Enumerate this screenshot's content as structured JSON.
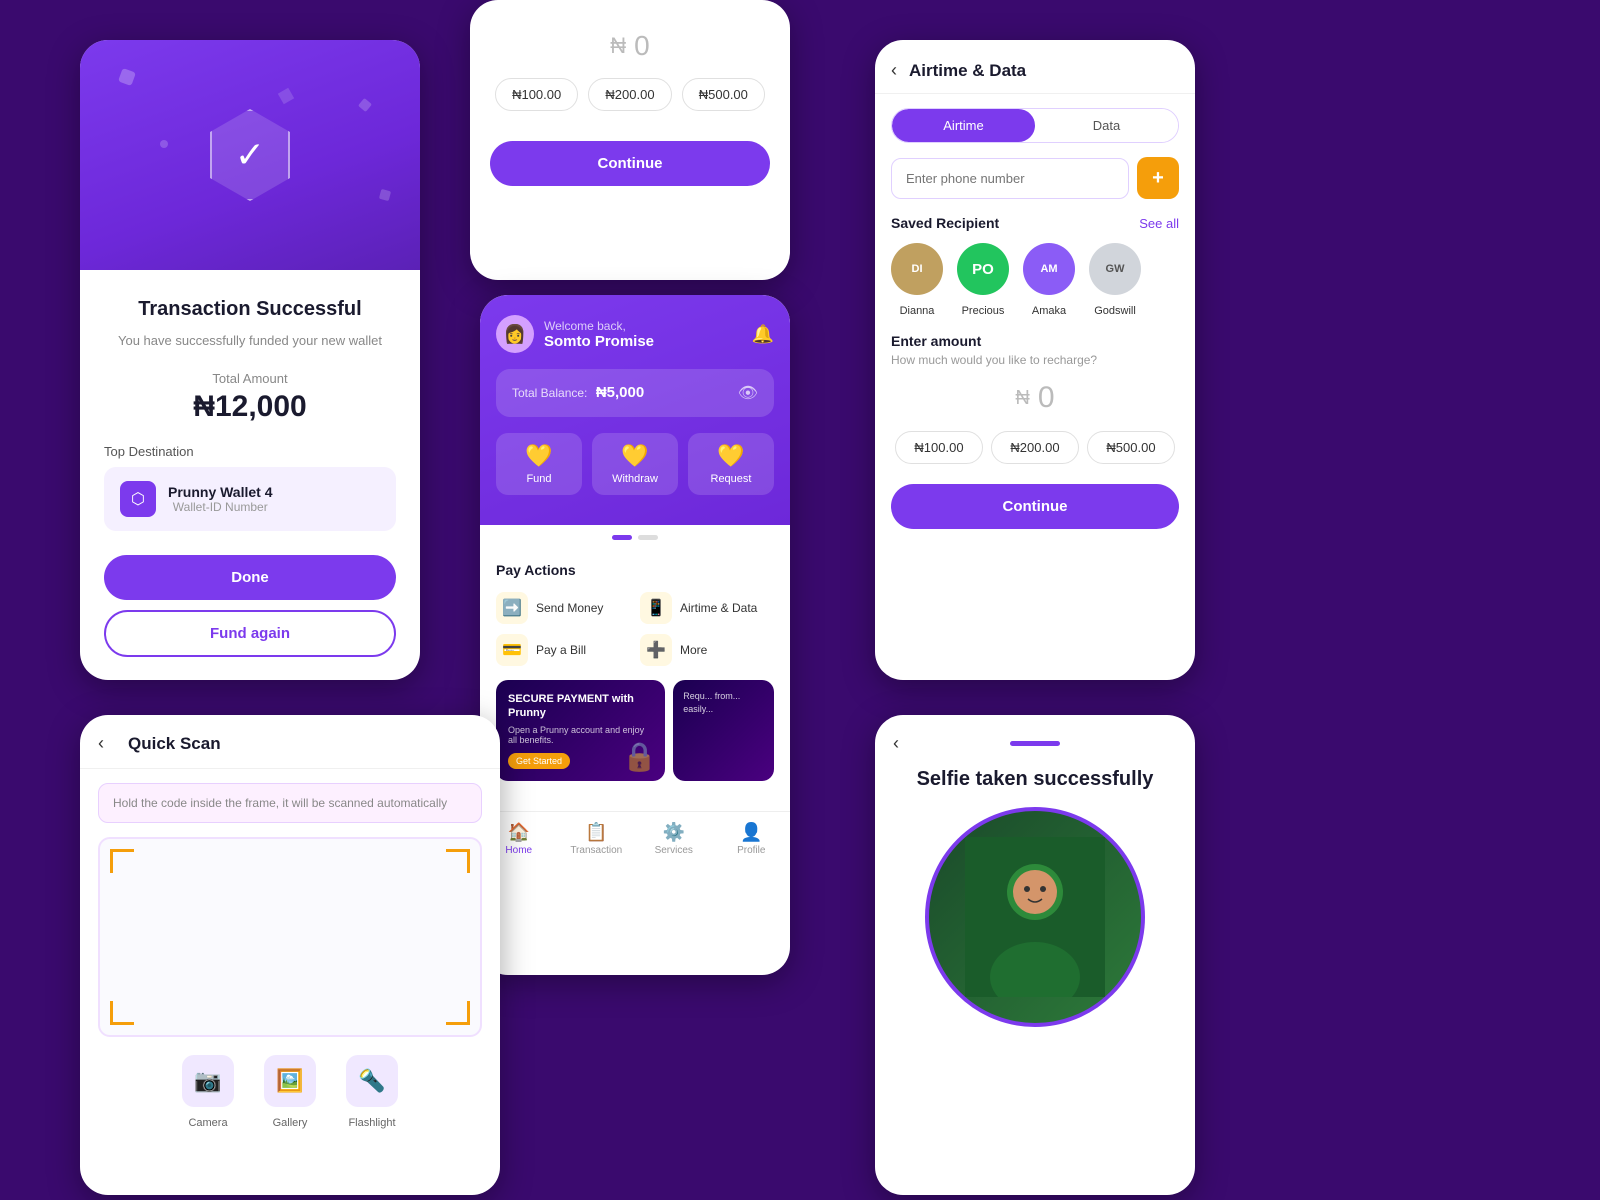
{
  "colors": {
    "purple": "#7c3aed",
    "dark_purple": "#3a0a6e",
    "yellow": "#f59e0b",
    "white": "#ffffff"
  },
  "card_transaction": {
    "badge_check": "✓",
    "title": "Transaction Successful",
    "subtitle": "You have successfully funded your new wallet",
    "total_amount_label": "Total Amount",
    "amount": "₦12,000",
    "top_destination_label": "Top Destination",
    "wallet_name": "Prunny Wallet 4",
    "wallet_sub": "Wallet-ID Number",
    "btn_done": "Done",
    "btn_fund_again": "Fund again"
  },
  "card_airtime_top": {
    "naira_symbol": "₦",
    "amount": "0",
    "quick_amounts": [
      "₦100.00",
      "₦200.00",
      "₦500.00"
    ],
    "btn_continue": "Continue"
  },
  "card_home": {
    "welcome": "Welcome back,",
    "user_name": "Somto Promise",
    "total_balance_label": "Total Balance:",
    "total_balance": "₦5,000",
    "actions": [
      {
        "label": "Fund",
        "icon": "💛"
      },
      {
        "label": "Withdraw",
        "icon": "💛"
      },
      {
        "label": "Request",
        "icon": "💛"
      }
    ],
    "pay_actions_title": "Pay Actions",
    "pay_items": [
      {
        "label": "Send Money",
        "icon": "🟡"
      },
      {
        "label": "Airtime & Data",
        "icon": "📱"
      },
      {
        "label": "Pay a Bill",
        "icon": "💳"
      },
      {
        "label": "More",
        "icon": "➕"
      }
    ],
    "banner_title": "SECURE PAYMENT with Prunny",
    "banner_subtitle": "Open a Prunny account and enjoy all benefits.",
    "banner_cta": "Get Started",
    "banner_side_text": "Requ... from... easily...",
    "nav_items": [
      {
        "label": "Home",
        "icon": "🏠",
        "active": true
      },
      {
        "label": "Transaction",
        "icon": "📋",
        "active": false
      },
      {
        "label": "Services",
        "icon": "⚙️",
        "active": false
      },
      {
        "label": "Profile",
        "icon": "👤",
        "active": false
      }
    ]
  },
  "card_airtime_full": {
    "title": "Airtime & Data",
    "tab_airtime": "Airtime",
    "tab_data": "Data",
    "phone_placeholder": "Enter phone number",
    "add_btn": "+",
    "saved_recipients_title": "Saved Recipient",
    "see_all": "See all",
    "recipients": [
      {
        "name": "Dianna",
        "initials": "DI",
        "bg": "#c0a060"
      },
      {
        "name": "Precious",
        "initials": "PO",
        "bg": "#22c55e"
      },
      {
        "name": "Amaka",
        "initials": "AM",
        "bg": "#8b5cf6"
      },
      {
        "name": "Godswill",
        "initials": "GW",
        "bg": "#d1d5db"
      }
    ],
    "enter_amount_title": "Enter amount",
    "enter_amount_sub": "How much would you like to recharge?",
    "naira_symbol": "₦",
    "amount": "0",
    "quick_amounts": [
      "₦100.00",
      "₦200.00",
      "₦500.00"
    ],
    "btn_continue": "Continue"
  },
  "card_quick_scan": {
    "title": "Quick Scan",
    "hint": "Hold the code inside the frame, it will be scanned automatically",
    "icons": [
      {
        "label": "Camera",
        "icon": "📷"
      },
      {
        "label": "Gallery",
        "icon": "🖼️"
      },
      {
        "label": "Flashlight",
        "icon": "🔦"
      }
    ]
  },
  "card_selfie": {
    "title": "Selfie taken successfully",
    "emoji": "👤"
  }
}
